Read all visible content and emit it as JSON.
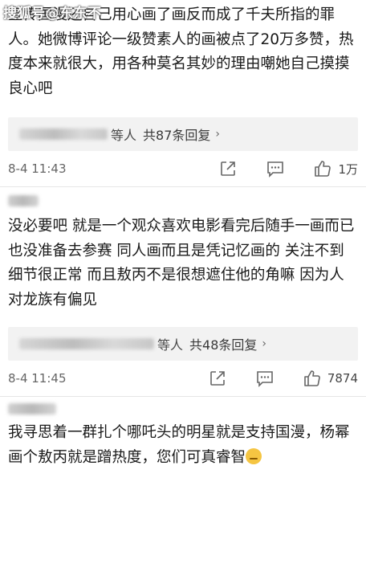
{
  "watermark": "搜狐号@东东不",
  "comments": [
    {
      "text": "宣传国漫还自己用心画了画反而成了千夫所指的罪人。她微博评论一级赞素人的画被点了20万多赞，热度本来就很大，用各种莫名其妙的理由嘲她自己摸摸良心吧",
      "reply_suffix": "等人",
      "reply_count": "共87条回复",
      "time": "8-4 11:43",
      "likes": "1万"
    },
    {
      "text": "没必要吧 就是一个观众喜欢电影看完后随手一画而已 也没准备去参赛 同人画而且是凭记忆画的 关注不到细节很正常 而且敖丙不是很想遮住他的角嘛 因为人对龙族有偏见",
      "reply_suffix": "等人",
      "reply_count": "共48条回复",
      "time": "8-4 11:45",
      "likes": "7874"
    },
    {
      "text": "我寻思着一群扎个哪吒头的明星就是支持国漫，杨幂画个敖丙就是蹭热度，您们可真睿智"
    }
  ],
  "icons": {
    "share": "share-icon",
    "comment": "comment-icon",
    "like": "thumbs-up-icon",
    "reply_chevron": "chevron-right-icon",
    "emoji": "smirk-emoji-icon"
  }
}
